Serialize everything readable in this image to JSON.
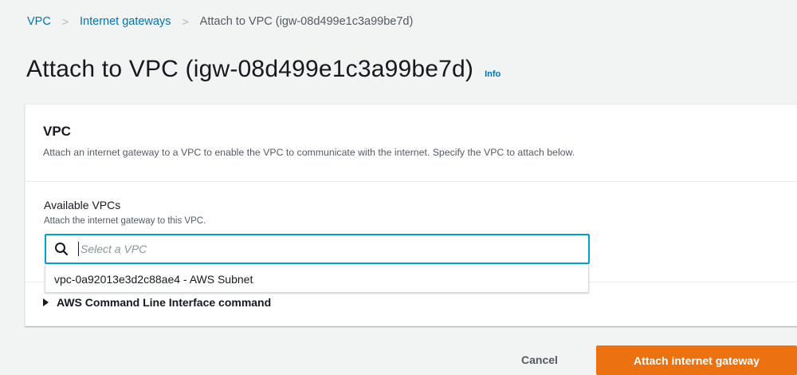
{
  "breadcrumb": {
    "items": [
      {
        "label": "VPC"
      },
      {
        "label": "Internet gateways"
      },
      {
        "label": "Attach to VPC (igw-08d499e1c3a99be7d)"
      }
    ],
    "separator": ">"
  },
  "page": {
    "title": "Attach to VPC (igw-08d499e1c3a99be7d)",
    "info_label": "Info"
  },
  "panel": {
    "title": "VPC",
    "description": "Attach an internet gateway to a VPC to enable the VPC to communicate with the internet. Specify the VPC to attach below.",
    "field": {
      "label": "Available VPCs",
      "description": "Attach the internet gateway to this VPC.",
      "placeholder": "Select a VPC",
      "icon": "search-icon"
    },
    "dropdown": {
      "options": [
        "vpc-0a92013e3d2c88ae4 - AWS Subnet"
      ]
    },
    "cli": {
      "label": "AWS Command Line Interface command",
      "icon": "caret-right-icon"
    }
  },
  "actions": {
    "cancel_label": "Cancel",
    "primary_label": "Attach internet gateway"
  },
  "colors": {
    "link": "#0073bb",
    "primary": "#ec7211",
    "focus": "#00a1c9",
    "background": "#f2f3f3"
  }
}
